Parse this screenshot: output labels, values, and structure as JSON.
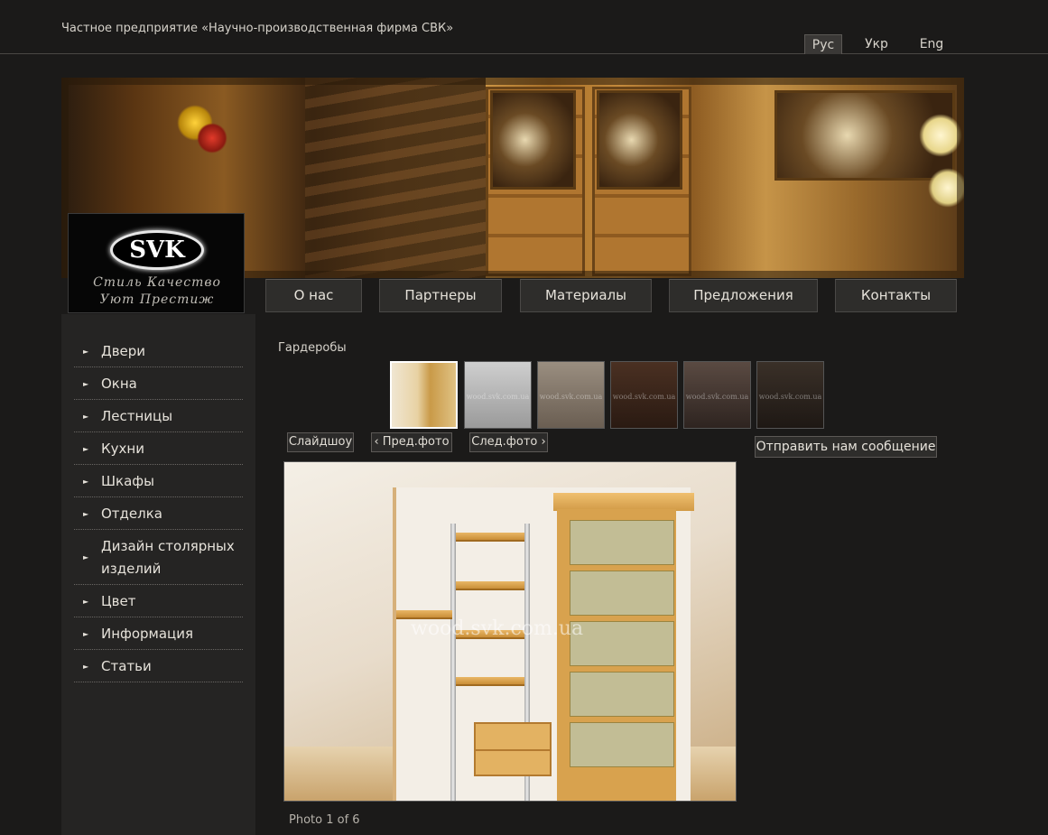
{
  "header": {
    "company": "Частное предприятие «Научно-производственная фирма СВК»",
    "languages": [
      "Рус",
      "Укр",
      "Eng"
    ]
  },
  "logo": {
    "mark": "SVK",
    "tagline_1": "Стиль Качество",
    "tagline_2": "Уют Престиж"
  },
  "nav": [
    "О нас",
    "Партнеры",
    "Материалы",
    "Предложения",
    "Контакты"
  ],
  "sidebar": {
    "items": [
      "Двери",
      "Окна",
      "Лестницы",
      "Кухни",
      "Шкафы",
      "Отделка",
      "Дизайн столярных изделий",
      "Цвет",
      "Информация",
      "Статьи"
    ]
  },
  "gallery": {
    "title": "Гардеробы",
    "thumb_watermark": "wood.svk.com.ua",
    "slideshow_label": "Слайдшоу",
    "prev_label": "‹ Пред.фото",
    "next_label": "След.фото ›",
    "send_label": "Отправить нам сообщение",
    "photo_watermark": "wood.svk.com.ua",
    "caption": "Photo 1 of 6"
  }
}
